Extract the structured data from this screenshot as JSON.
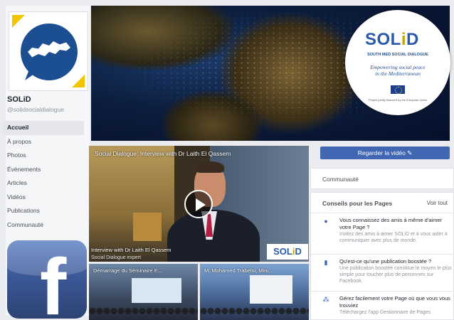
{
  "page": {
    "name": "SOLiD",
    "handle": "@solidsocialdialogue"
  },
  "nav": {
    "items": [
      "Accueil",
      "À propos",
      "Photos",
      "Évènements",
      "Articles",
      "Vidéos",
      "Publications",
      "Communauté"
    ],
    "active": "Accueil"
  },
  "cover": {
    "logo_text": "SOLiD",
    "subtitle": "SOUTH MED SOCIAL DIALOGUE",
    "tagline_line1": "Empowering social peace",
    "tagline_line2": "in the Mediterranean",
    "funding_note": "Project jointly financed by the European Union"
  },
  "video": {
    "title": "Social Dialogue: Interview with Dr Laith El Qassem",
    "caption": "Interview with Dr Laith El Qassem",
    "caption2": "Social Dialogue expert",
    "logo_text": "SOLiD"
  },
  "thumbnails": [
    {
      "title": "Démarrage du Séminaire E..."
    },
    {
      "title": "M. Mohamed Trabelsi, Mini..."
    }
  ],
  "sidebar_right": {
    "watch_button": "Regarder la vidéo ✎",
    "community_label": "Communauté",
    "tips_heading": "Conseils pour les Pages",
    "tips_all": "Voir tout",
    "tips": [
      {
        "icon": "person-pin-icon",
        "title": "Vous connaissez des amis à même d'aimer votre Page ?",
        "desc": "Invitez des amis à aimer SOLiD et à vous aider à communiquer avec plus de monde."
      },
      {
        "icon": "chart-icon",
        "title": "Qu'est-ce qu'une publication boostée ?",
        "desc": "Une publication boostée constitue le moyen le plus simple pour toucher plus de personnes sur Facebook."
      },
      {
        "icon": "network-icon",
        "title": "Gérez facilement votre Page où que vous vous trouviez",
        "desc": "Téléchargez l'app Gestionnaire de Pages"
      }
    ]
  },
  "colors": {
    "facebook_blue": "#4267b2",
    "solid_blue": "#2a5aa8",
    "solid_gold": "#c9a400"
  }
}
